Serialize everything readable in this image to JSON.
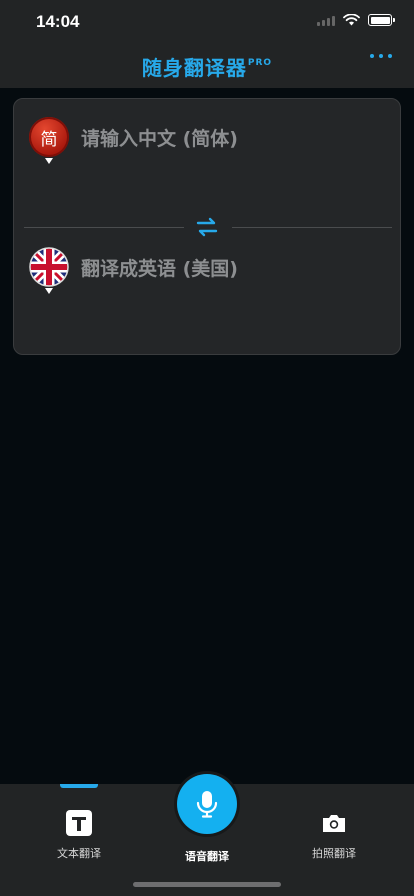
{
  "status_bar": {
    "time": "14:04"
  },
  "header": {
    "title": "随身翻译器",
    "title_badge": "PRO"
  },
  "card": {
    "source": {
      "badge_char": "简",
      "label": "请输入中文 (简体)"
    },
    "target": {
      "label": "翻译成英语 (美国)"
    }
  },
  "tabs": {
    "text": "文本翻译",
    "voice": "语音翻译",
    "photo": "拍照翻译",
    "active": "text"
  },
  "colors": {
    "accent": "#27a9ea",
    "mic": "#14b0f0",
    "background": "#050b0f",
    "bar": "#222425"
  }
}
